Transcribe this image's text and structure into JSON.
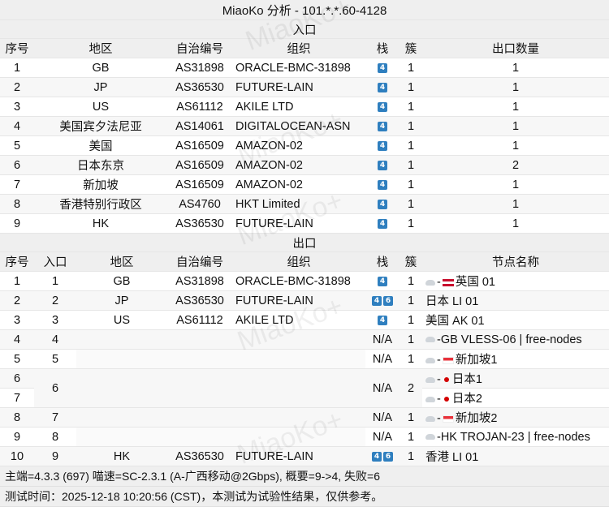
{
  "title": "MiaoKo 分析 - 101.*.*.60-4128",
  "watermark": "MiaoKo+",
  "entry": {
    "section_title": "入口",
    "headers": [
      "序号",
      "地区",
      "自治编号",
      "组织",
      "栈",
      "簇",
      "出口数量"
    ],
    "rows": [
      {
        "idx": "1",
        "region": "GB",
        "asn": "AS31898",
        "org": "ORACLE-BMC-31898",
        "stack": [
          "4"
        ],
        "cluster": "1",
        "count": "1"
      },
      {
        "idx": "2",
        "region": "JP",
        "asn": "AS36530",
        "org": "FUTURE-LAIN",
        "stack": [
          "4"
        ],
        "cluster": "1",
        "count": "1"
      },
      {
        "idx": "3",
        "region": "US",
        "asn": "AS61112",
        "org": "AKILE LTD",
        "stack": [
          "4"
        ],
        "cluster": "1",
        "count": "1"
      },
      {
        "idx": "4",
        "region": "美国宾夕法尼亚",
        "asn": "AS14061",
        "org": "DIGITALOCEAN-ASN",
        "stack": [
          "4"
        ],
        "cluster": "1",
        "count": "1"
      },
      {
        "idx": "5",
        "region": "美国",
        "asn": "AS16509",
        "org": "AMAZON-02",
        "stack": [
          "4"
        ],
        "cluster": "1",
        "count": "1"
      },
      {
        "idx": "6",
        "region": "日本东京",
        "asn": "AS16509",
        "org": "AMAZON-02",
        "stack": [
          "4"
        ],
        "cluster": "1",
        "count": "2"
      },
      {
        "idx": "7",
        "region": "新加坡",
        "asn": "AS16509",
        "org": "AMAZON-02",
        "stack": [
          "4"
        ],
        "cluster": "1",
        "count": "1"
      },
      {
        "idx": "8",
        "region": "香港特别行政区",
        "asn": "AS4760",
        "org": "HKT Limited",
        "stack": [
          "4"
        ],
        "cluster": "1",
        "count": "1"
      },
      {
        "idx": "9",
        "region": "HK",
        "asn": "AS36530",
        "org": "FUTURE-LAIN",
        "stack": [
          "4"
        ],
        "cluster": "1",
        "count": "1"
      }
    ]
  },
  "exit": {
    "section_title": "出口",
    "headers": [
      "序号",
      "入口",
      "地区",
      "自治编号",
      "组织",
      "栈",
      "簇",
      "节点名称"
    ],
    "rows": [
      {
        "idx": "1",
        "entry": "1",
        "region": "GB",
        "asn": "AS31898",
        "org": "ORACLE-BMC-31898",
        "stack": [
          "4"
        ],
        "cluster": "1",
        "node_prefix": "-",
        "flag": "uk",
        "node": "英国 01"
      },
      {
        "idx": "2",
        "entry": "2",
        "region": "JP",
        "asn": "AS36530",
        "org": "FUTURE-LAIN",
        "stack": [
          "4",
          "6"
        ],
        "cluster": "1",
        "node": "日本 LI 01"
      },
      {
        "idx": "3",
        "entry": "3",
        "region": "US",
        "asn": "AS61112",
        "org": "AKILE LTD",
        "stack": [
          "4"
        ],
        "cluster": "1",
        "node": "美国 AK 01"
      },
      {
        "idx": "4",
        "entry": "4",
        "stack_text": "N/A",
        "cluster": "1",
        "node_prefix": "",
        "node": "-GB VLESS-06 | free-nodes"
      },
      {
        "idx": "5",
        "entry": "5",
        "stack_text": "N/A",
        "cluster": "1",
        "node_prefix": "-",
        "flag": "sg",
        "node": "新加坡1"
      },
      {
        "idx": "6",
        "entry": "6",
        "stack_text": "N/A",
        "cluster": "2",
        "node_prefix": "-",
        "flag": "jp",
        "node": "日本1"
      },
      {
        "idx": "7",
        "node_prefix": "-",
        "flag": "jp",
        "node": "日本2"
      },
      {
        "idx": "8",
        "entry": "7",
        "stack_text": "N/A",
        "cluster": "1",
        "node_prefix": "-",
        "flag": "sg",
        "node": "新加坡2"
      },
      {
        "idx": "9",
        "entry": "8",
        "stack_text": "N/A",
        "cluster": "1",
        "node_prefix": "",
        "node": "-HK TROJAN-23 | free-nodes"
      },
      {
        "idx": "10",
        "entry": "9",
        "region": "HK",
        "asn": "AS36530",
        "org": "FUTURE-LAIN",
        "stack": [
          "4",
          "6"
        ],
        "cluster": "1",
        "node": "香港 LI 01"
      }
    ]
  },
  "footer": {
    "line1": "主端=4.3.3 (697) 喵速=SC-2.3.1 (A-广西移动@2Gbps), 概要=9->4, 失败=6",
    "line2": "测试时间：2025-12-18 10:20:56 (CST)，本测试为试验性结果，仅供参考。"
  }
}
